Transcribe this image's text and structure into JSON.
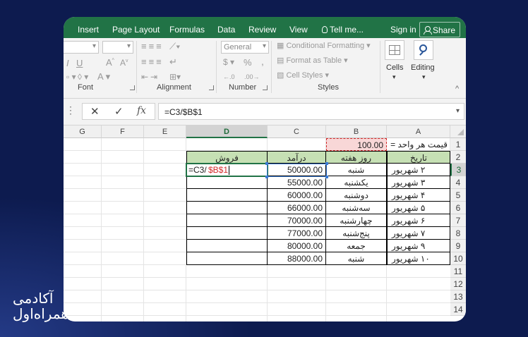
{
  "tabs": [
    "Insert",
    "Page Layout",
    "Formulas",
    "Data",
    "Review",
    "View"
  ],
  "tell_me": "Tell me...",
  "sign_in": "Sign in",
  "share": "Share",
  "ribbon": {
    "number_format": "General",
    "percent": "%",
    "comma": ",",
    "conditional_formatting": "Conditional Formatting",
    "format_as_table": "Format as Table",
    "cell_styles": "Cell Styles",
    "cells": "Cells",
    "editing": "Editing",
    "groups": {
      "font": "Font",
      "alignment": "Alignment",
      "number": "Number",
      "styles": "Styles"
    }
  },
  "formula_bar": {
    "cancel": "✕",
    "enter": "✓",
    "fx": "fx",
    "formula": "=C3/$B$1"
  },
  "columns": [
    "G",
    "F",
    "E",
    "D",
    "C",
    "B",
    "A"
  ],
  "rows": [
    "1",
    "2",
    "3",
    "4",
    "5",
    "6",
    "7",
    "8",
    "9",
    "10",
    "11",
    "12",
    "13",
    "14"
  ],
  "sheet": {
    "a1": "قیمت هر واحد =",
    "b1": "100.00",
    "headers": {
      "date": "تاریخ",
      "day": "روز هفته",
      "income": "درآمد",
      "sales": "فروش"
    },
    "edit_formula_a": "=C3/",
    "edit_formula_b": "$B$1",
    "data_rows": [
      {
        "date": "۲ شهریور",
        "day": "شنبه",
        "income": "50000.00"
      },
      {
        "date": "۳ شهریور",
        "day": "یکشنبه",
        "income": "55000.00"
      },
      {
        "date": "۴ شهریور",
        "day": "دوشنبه",
        "income": "60000.00"
      },
      {
        "date": "۵ شهریور",
        "day": "سه‌شنبه",
        "income": "66000.00"
      },
      {
        "date": "۶ شهریور",
        "day": "چهارشنبه",
        "income": "70000.00"
      },
      {
        "date": "۷ شهریور",
        "day": "پنج‌شنبه",
        "income": "77000.00"
      },
      {
        "date": "۹ شهریور",
        "day": "جمعه",
        "income": "80000.00"
      },
      {
        "date": "۱۰ شهریور",
        "day": "شنبه",
        "income": "88000.00"
      }
    ]
  },
  "logo": {
    "line1": "آکادمی",
    "line2": "همراه‌اول"
  },
  "colors": {
    "excel_green": "#217346",
    "header_fill": "#c6e0b4",
    "b1_fill": "#f8d7d7",
    "ref_red": "#d42b2b"
  }
}
